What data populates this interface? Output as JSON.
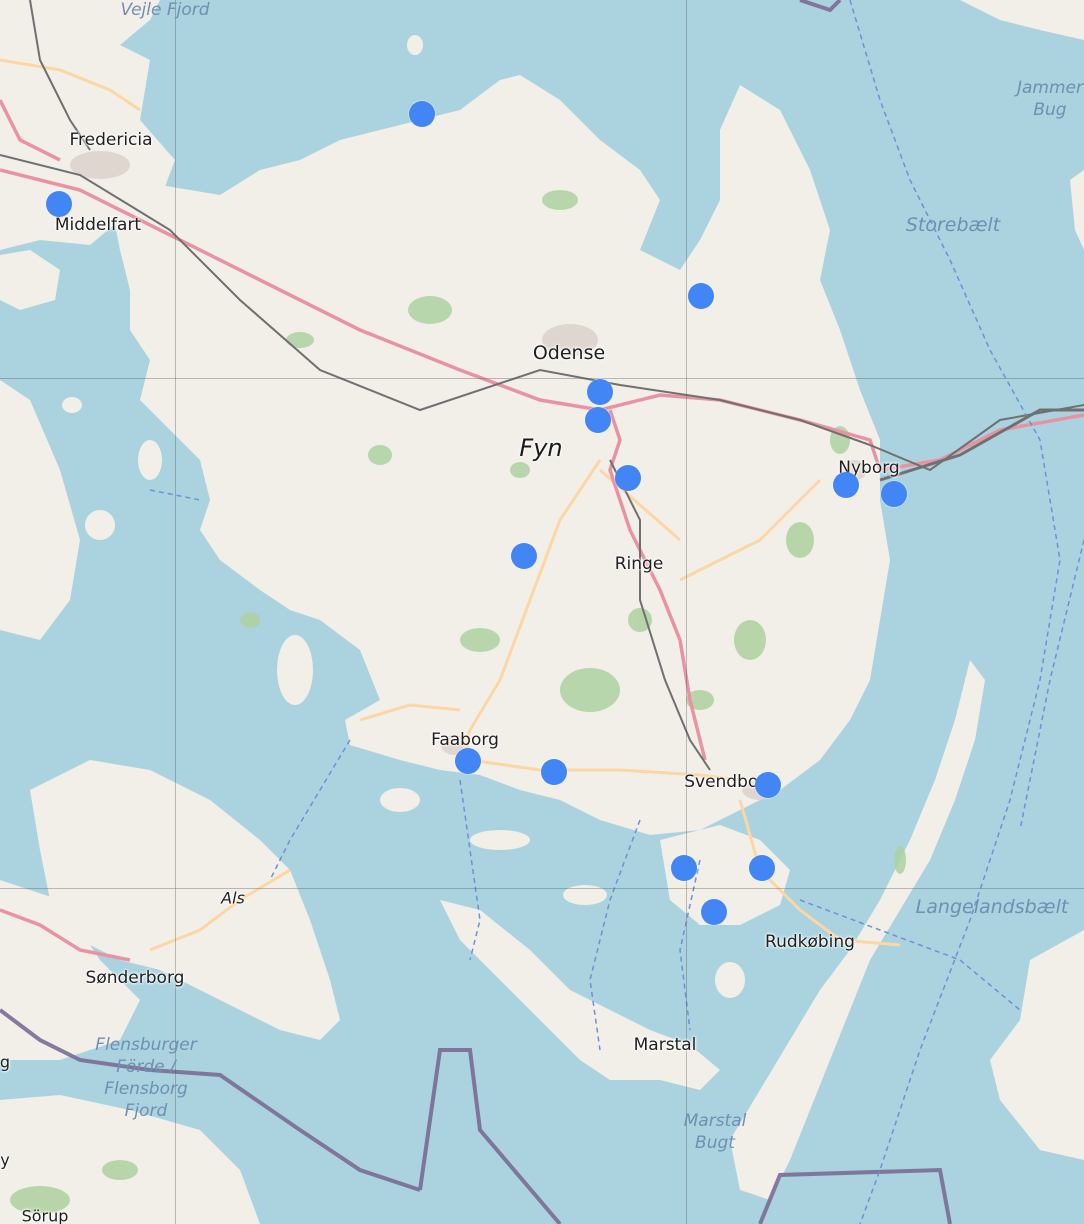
{
  "map": {
    "labels": {
      "vejle_fjord": "Vejle Fjord",
      "fredericia": "Fredericia",
      "middelfart": "Middelfart",
      "odense": "Odense",
      "fyn": "Fyn",
      "nyborg": "Nyborg",
      "ringe": "Ringe",
      "faaborg": "Faaborg",
      "svendborg": "Svendborg",
      "rudkobing": "Rudkøbing",
      "marstal": "Marstal",
      "sonderborg": "Sønderborg",
      "als": "Als",
      "storebaelt": "Storebælt",
      "langelandsbaelt": "Langelandsbælt",
      "jammer_bugt": "Jammer Bug",
      "flensburger_forde": "Flensburger Förde / Flensborg Fjord",
      "marstal_bugt": "Marstal Bugt",
      "sorup": "Sörup",
      "edge_y": "y",
      "edge_g": "g"
    },
    "colors": {
      "water": "#aad3df",
      "land": "#f2efe9",
      "forest": "#aed1a0",
      "marker": "#4285f4",
      "motorway": "#e892a2",
      "primary_road": "#fcd6a4",
      "railway": "#707070",
      "border": "#7b6b95"
    },
    "markers": [
      {
        "name": "marker-1"
      },
      {
        "name": "marker-2"
      },
      {
        "name": "marker-3"
      },
      {
        "name": "marker-4"
      },
      {
        "name": "marker-5"
      },
      {
        "name": "marker-6"
      },
      {
        "name": "marker-7"
      },
      {
        "name": "marker-8"
      },
      {
        "name": "marker-9"
      },
      {
        "name": "marker-10"
      },
      {
        "name": "marker-11"
      },
      {
        "name": "marker-12"
      },
      {
        "name": "marker-13"
      },
      {
        "name": "marker-14"
      },
      {
        "name": "marker-15"
      },
      {
        "name": "marker-16"
      }
    ]
  }
}
